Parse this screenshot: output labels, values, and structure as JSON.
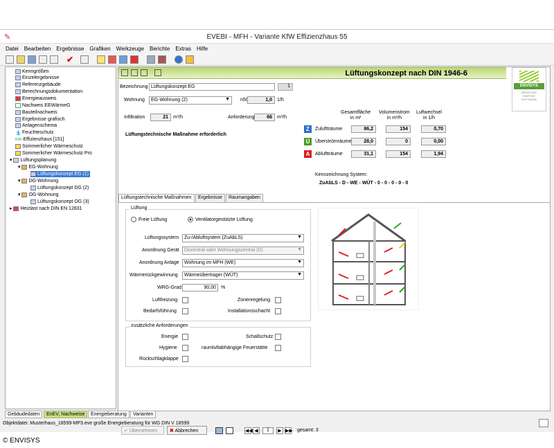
{
  "window": {
    "title": "EVEBI - MFH - Variante KfW Effizienzhaus 55"
  },
  "menu": [
    "Datei",
    "Bearbeiten",
    "Ergebnisse",
    "Grafiken",
    "Werkzeuge",
    "Berichte",
    "Extras",
    "Hilfe"
  ],
  "tree": [
    "Kenngrößen",
    "Einzelergebnisse",
    "Referenzgebäude",
    "Berechnungsdokumentation",
    "Energieausweis",
    "Nachweis EEWärmeG",
    "Bauteilnachweis",
    "Ergebnisse grafisch",
    "Anlagenschema",
    "Feuchteschutz",
    "Effizienzhaus [151]",
    "Sommerlicher Wärmeschutz",
    "Sommerlicher Wärmeschutz Pro",
    "Lüftungsplanung",
    "EG-Wohnung",
    "Lüftungskonzept EG (1)",
    "DG-Wohnung",
    "Lüftungskonzept DG (2)",
    "OG-Wohnung",
    "Lüftungskonzept OG (3)",
    "Heizlast nach DIN EN 12831"
  ],
  "kfw_prefix": "KfW",
  "header_title": "Lüftungskonzept nach DIN 1946-6",
  "logo_text": "ENVISYS",
  "logo_sub": [
    "BERATUNG",
    "ENERGIE",
    "SOFTWARE"
  ],
  "form": {
    "bezeichnung_label": "Bezeichnung",
    "bezeichnung_value": "Lüftungskonzept EG",
    "counter": "1",
    "wohnung_label": "Wohnung",
    "wohnung_value": "EG-Wohnung (2)",
    "n50_label": "n50",
    "n50_value": "1,0",
    "n50_unit": "1/h",
    "infiltration_label": "Infiltration",
    "infiltration_value": "21",
    "infiltration_unit": "m³/h",
    "anforderung_label": "Anforderungswert",
    "anforderung_value": "66",
    "anforderung_unit": "m³/h",
    "massnahme": "Lüftungstechnische Maßnahme erforderlich"
  },
  "table": {
    "headers": [
      "Gesamtfläche\nin m²",
      "Volumenstrom\nin m³/h",
      "Luftwechsel\nin 1/h"
    ],
    "rows": [
      {
        "badge": "Z",
        "color": "#2f6fc6",
        "label": "Zuluftträume",
        "values": [
          "86,2",
          "154",
          "0,70"
        ]
      },
      {
        "badge": "Ü",
        "color": "#4a9c2a",
        "label": "Überströmräume",
        "values": [
          "28,0",
          "0",
          "0,00"
        ]
      },
      {
        "badge": "A",
        "color": "#d42020",
        "label": "Abluftträume",
        "values": [
          "31,1",
          "154",
          "1,94"
        ]
      }
    ]
  },
  "kennzeichnung_label": "Kennzeichnung System:",
  "kennzeichnung_value": "ZuAbLS - D - WE - WÜT - 0 - 0 - 0 - 0 - 0",
  "tabs": [
    "Lüftungstechnische Maßnahmen",
    "Ergebnisse",
    "Raumangaben"
  ],
  "lueftung": {
    "group": "Lüftung",
    "radio1": "Freie Lüftung",
    "radio2": "Ventilatorgestützte Lüftung",
    "fields": [
      {
        "label": "Lüftungssystem",
        "value": "Zu-/Abluftsystem (ZuAbLS)",
        "disabled": false
      },
      {
        "label": "Anordnung Gerät",
        "value": "Dezentral oder Wohnungszentral (D)",
        "disabled": true
      },
      {
        "label": "Anordnung Anlage",
        "value": "Wohnung im MFH (WE)",
        "disabled": false
      },
      {
        "label": "Wärmerückgewinnung",
        "value": "Wärmeübertrager (WÜT)",
        "disabled": false
      }
    ],
    "wrg_label": "WRG-Grad",
    "wrg_value": "90,00",
    "wrg_unit": "%",
    "checks": [
      "Luftheizung",
      "Zonenregelung",
      "Bedarfsführung",
      "Installationsschacht"
    ]
  },
  "zusatz": {
    "group": "zusätzliche Anforderungen",
    "checks": [
      "Energie",
      "Schallschutz",
      "Hygiene",
      "raumluftabhängige Feuerstätte",
      "Rückschlagklappe"
    ]
  },
  "buttons": {
    "uebernehmen": "Übernehmen",
    "abbrechen": "Abbrechen"
  },
  "pager": {
    "page": "1",
    "total": "gesamt: 3"
  },
  "bottom_tabs": [
    "Gebäudedaten",
    "EnEV, Nachweise",
    "Energieberatung",
    "Varianten"
  ],
  "status": "Objektdatei: Musterhaus_18599-MP3.eve  große Energieberatung für WG DIN V 18599",
  "copyright": "© ENVISYS"
}
